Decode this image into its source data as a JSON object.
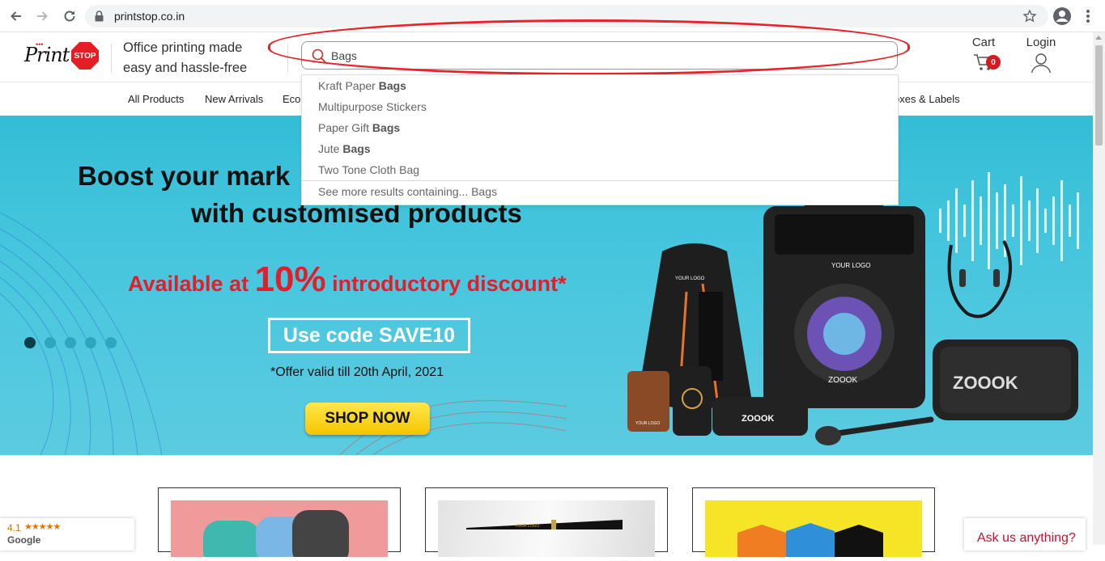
{
  "browser": {
    "url": "printstop.co.in"
  },
  "header": {
    "logo_text": "Print",
    "logo_badge": "STOP",
    "tagline_line1": "Office printing made",
    "tagline_line2": "easy and hassle-free",
    "cart_label": "Cart",
    "cart_count": "0",
    "login_label": "Login"
  },
  "search": {
    "value": "Bags",
    "suggestions": [
      {
        "prefix": "Kraft Paper ",
        "bold": "Bags"
      },
      {
        "prefix": "Multipurpose Stickers",
        "bold": ""
      },
      {
        "prefix": "Paper Gift ",
        "bold": "Bags"
      },
      {
        "prefix": "Jute ",
        "bold": "Bags"
      },
      {
        "prefix": "Two Tone Cloth Bag",
        "bold": ""
      }
    ],
    "see_more": "See more results containing... Bags"
  },
  "nav": {
    "items": [
      "All Products",
      "New Arrivals",
      "Eco",
      "oxes & Labels"
    ]
  },
  "banner": {
    "headline1": "Boost your mark",
    "headline2": "with customised products",
    "discount_pre": "Available at ",
    "discount_big": "10%",
    "discount_post": " introductory discount*",
    "code": "Use code SAVE10",
    "validity": "*Offer valid till 20th April, 2021",
    "shop_now": "SHOP NOW",
    "your_logo": "YOUR LOGO",
    "brand": "ZOOOK",
    "slides": 5,
    "active_slide": 1
  },
  "widgets": {
    "rating_value": "4.1",
    "rating_stars": "★★★★★",
    "rating_source": "Google",
    "chat_prompt": "Ask us anything?"
  }
}
